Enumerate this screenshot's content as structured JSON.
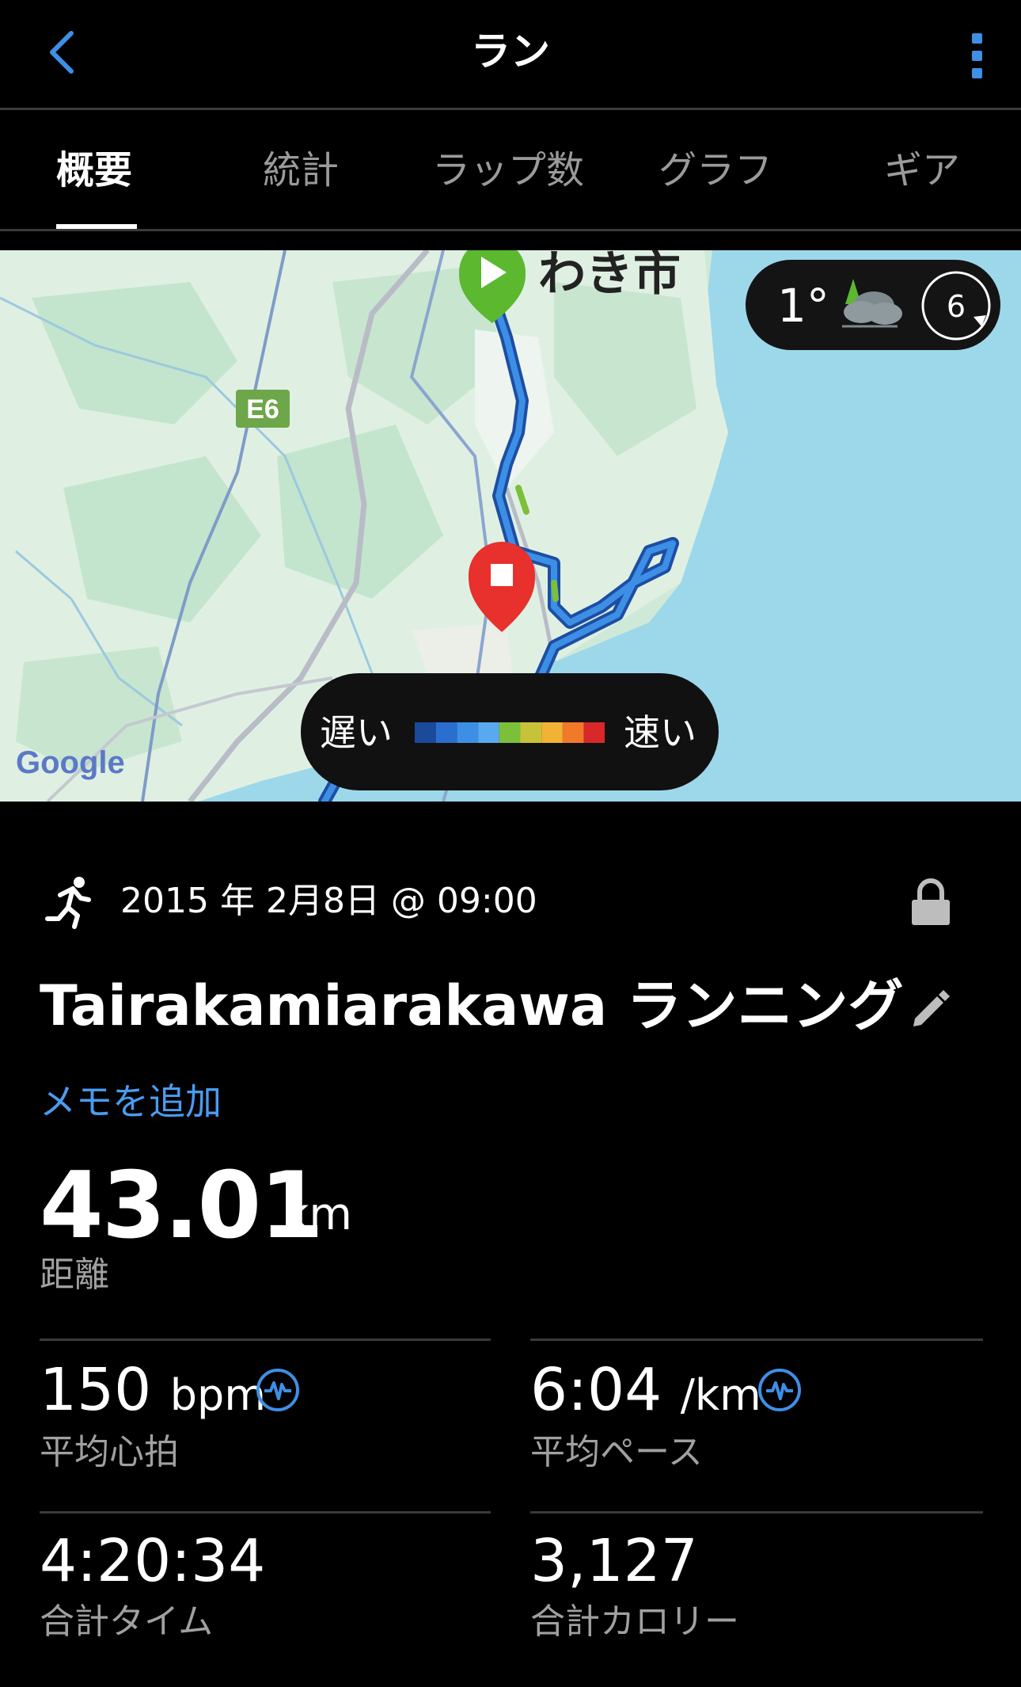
{
  "header": {
    "title": "ラン",
    "back_icon": "chevron-left-icon",
    "menu_icon": "more-vertical-icon",
    "accent": "#3e8fe6"
  },
  "tabs": [
    {
      "label": "概要",
      "active": true
    },
    {
      "label": "統計",
      "active": false
    },
    {
      "label": "ラップ数",
      "active": false
    },
    {
      "label": "グラフ",
      "active": false
    },
    {
      "label": "ギア",
      "active": false
    }
  ],
  "map": {
    "place_label": "わき市",
    "road_label": "E6",
    "provider": "Google",
    "weather": {
      "temperature": "1°",
      "icon": "cloud-with-tree-icon",
      "wind_value": "6"
    },
    "legend": {
      "slow": "遅い",
      "fast": "速い",
      "colors": [
        "#1c4a9a",
        "#2a6fd0",
        "#3d8fe6",
        "#5aa9ef",
        "#7cc03a",
        "#c6c33a",
        "#f2b233",
        "#f07a2a",
        "#d8282a"
      ]
    }
  },
  "activity": {
    "icon": "running-person-icon",
    "date": "2015 年 2月8日 @ 09:00",
    "lock_icon": "lock-icon",
    "title": "Tairakamiarakawa ランニング",
    "edit_icon": "pencil-icon",
    "add_memo": "メモを追加"
  },
  "distance": {
    "value": "43.01",
    "unit": "km",
    "label": "距離"
  },
  "stats": [
    {
      "value": "150",
      "unit": "bpm",
      "label": "平均心拍",
      "icon": "heart-rate-icon"
    },
    {
      "value": "6:04",
      "unit": "/km",
      "label": "平均ペース",
      "icon": "heart-rate-icon"
    },
    {
      "value": "4:20:34",
      "unit": "",
      "label": "合計タイム"
    },
    {
      "value": "3,127",
      "unit": "",
      "label": "合計カロリー"
    }
  ]
}
